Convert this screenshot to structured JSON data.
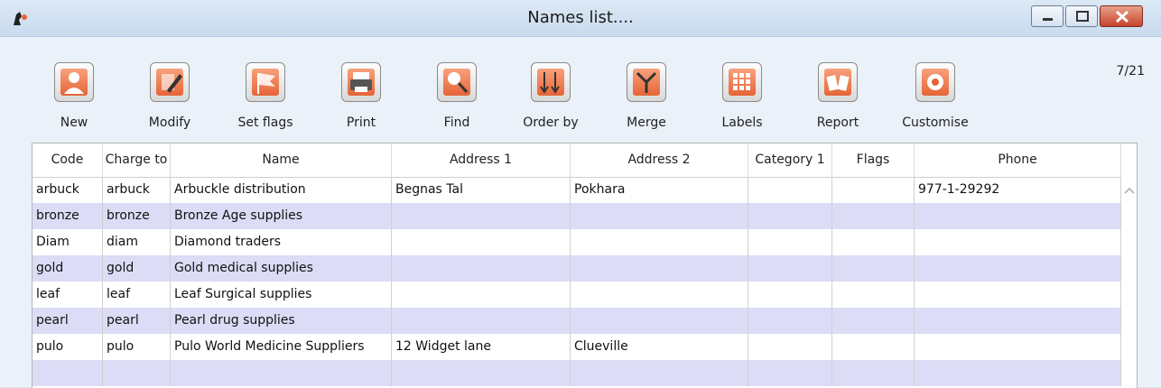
{
  "window": {
    "title": "Names list...."
  },
  "toolbar": {
    "buttons": [
      {
        "label": "New",
        "icon": "person-icon"
      },
      {
        "label": "Modify",
        "icon": "edit-icon"
      },
      {
        "label": "Set flags",
        "icon": "flag-icon"
      },
      {
        "label": "Print",
        "icon": "printer-icon"
      },
      {
        "label": "Find",
        "icon": "magnifier-icon"
      },
      {
        "label": "Order by",
        "icon": "sort-icon"
      },
      {
        "label": "Merge",
        "icon": "merge-icon"
      },
      {
        "label": "Labels",
        "icon": "labels-icon"
      },
      {
        "label": "Report",
        "icon": "report-icon"
      },
      {
        "label": "Customise",
        "icon": "gear-icon"
      }
    ],
    "counter": "7/21"
  },
  "table": {
    "headers": [
      "Code",
      "Charge to",
      "Name",
      "Address 1",
      "Address 2",
      "Category 1",
      "Flags",
      "Phone"
    ],
    "rows": [
      [
        "arbuck",
        "arbuck",
        "Arbuckle distribution",
        "Begnas Tal",
        "Pokhara",
        "",
        "",
        "977-1-29292"
      ],
      [
        "bronze",
        "bronze",
        "Bronze Age supplies",
        "",
        "",
        "",
        "",
        ""
      ],
      [
        "Diam",
        "diam",
        "Diamond traders",
        "",
        "",
        "",
        "",
        ""
      ],
      [
        "gold",
        "gold",
        "Gold medical supplies",
        "",
        "",
        "",
        "",
        ""
      ],
      [
        "leaf",
        "leaf",
        "Leaf Surgical supplies",
        "",
        "",
        "",
        "",
        ""
      ],
      [
        "pearl",
        "pearl",
        "Pearl drug supplies",
        "",
        "",
        "",
        "",
        ""
      ],
      [
        "pulo",
        "pulo",
        "Pulo World Medicine Suppliers",
        "12 Widget lane",
        "Clueville",
        "",
        "",
        ""
      ],
      [
        "",
        "",
        "",
        "",
        "",
        "",
        "",
        ""
      ]
    ]
  },
  "colors": {
    "accent": "#e66436",
    "row_alt": "#dcdcf6",
    "close": "#c8422c"
  }
}
